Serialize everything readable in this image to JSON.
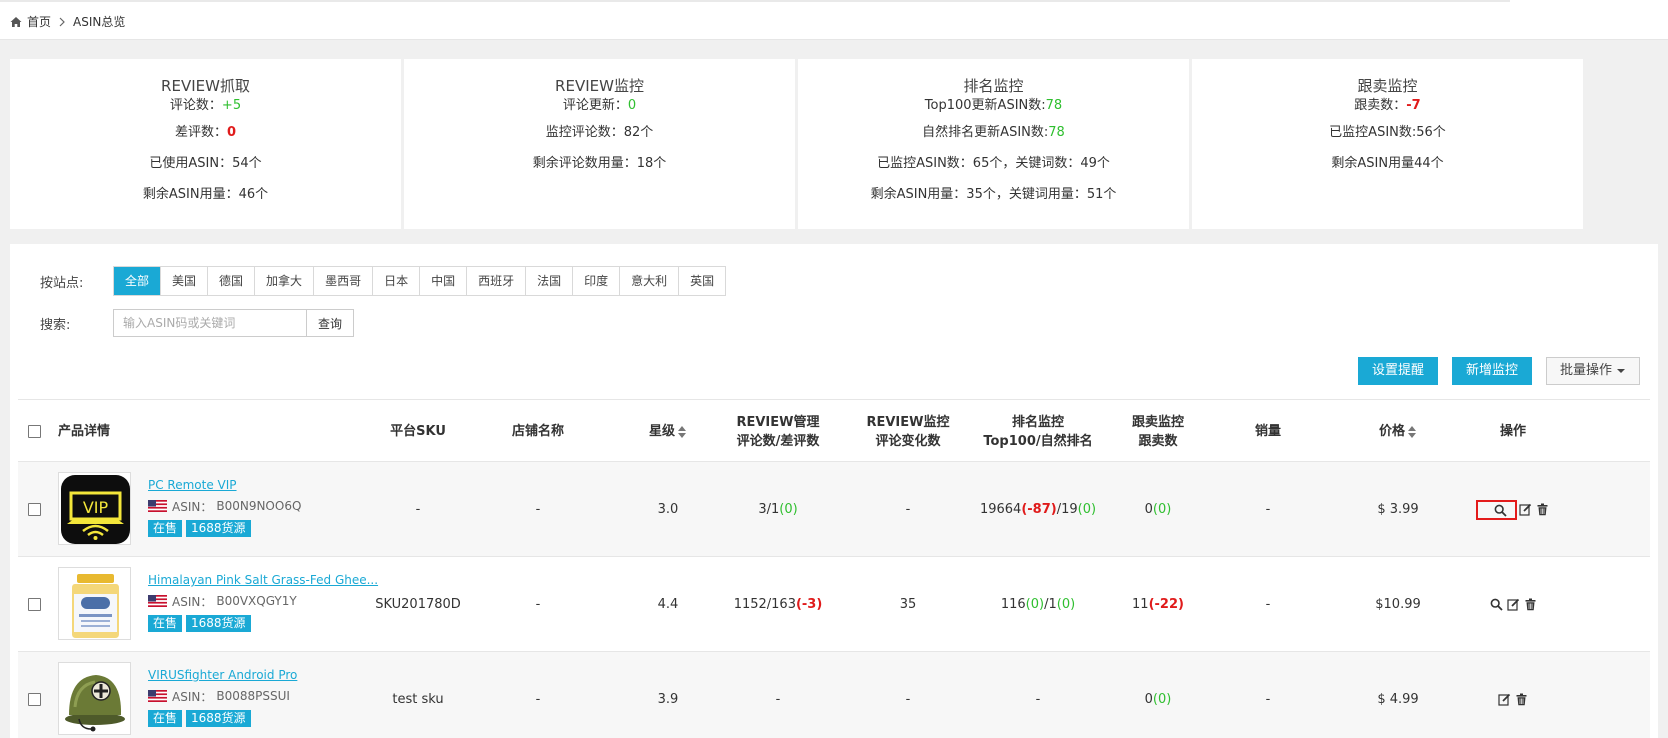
{
  "breadcrumb": {
    "home": "首页",
    "current": "ASIN总览"
  },
  "cards": [
    {
      "title": "REVIEW抓取",
      "rows": [
        {
          "label": "评论数：",
          "value": "+5",
          "style": "green"
        },
        {
          "label": "差评数：",
          "value": "0",
          "style": "red"
        },
        {
          "label": "已使用ASIN：54个",
          "value": "",
          "style": ""
        },
        {
          "label": "剩余ASIN用量：46个",
          "value": "",
          "style": ""
        }
      ]
    },
    {
      "title": "REVIEW监控",
      "rows": [
        {
          "label": "评论更新：",
          "value": "0",
          "style": "green"
        },
        {
          "label": "监控评论数：82个",
          "value": "",
          "style": ""
        },
        {
          "label": "剩余评论数用量：18个",
          "value": "",
          "style": ""
        }
      ]
    },
    {
      "title": "排名监控",
      "rows": [
        {
          "label": "Top100更新ASIN数:",
          "value": "78",
          "style": "green"
        },
        {
          "label": "自然排名更新ASIN数:",
          "value": "78",
          "style": "green"
        },
        {
          "label": "已监控ASIN数：65个，关键词数：49个",
          "value": "",
          "style": ""
        },
        {
          "label": "剩余ASIN用量：35个，关键词用量：51个",
          "value": "",
          "style": ""
        }
      ]
    },
    {
      "title": "跟卖监控",
      "rows": [
        {
          "label": "跟卖数：",
          "value": "-7",
          "style": "red"
        },
        {
          "label": "已监控ASIN数:56个",
          "value": "",
          "style": ""
        },
        {
          "label": "剩余ASIN用量44个",
          "value": "",
          "style": ""
        }
      ]
    }
  ],
  "filter": {
    "label": "按站点:",
    "sites": [
      "全部",
      "美国",
      "德国",
      "加拿大",
      "墨西哥",
      "日本",
      "中国",
      "西班牙",
      "法国",
      "印度",
      "意大利",
      "英国"
    ],
    "active": "全部"
  },
  "search": {
    "label": "搜索:",
    "placeholder": "输入ASIN码或关键词",
    "button": "查询"
  },
  "toolbar": {
    "remind": "设置提醒",
    "add": "新增监控",
    "batch": "批量操作"
  },
  "columns": {
    "product": "产品详情",
    "sku": "平台SKU",
    "store": "店铺名称",
    "stars": "星级",
    "review_mgmt": [
      "REVIEW管理",
      "评论数/差评数"
    ],
    "review_mon": [
      "REVIEW监控",
      "评论变化数"
    ],
    "rank": [
      "排名监控",
      "Top100/自然排名"
    ],
    "follow": [
      "跟卖监控",
      "跟卖数"
    ],
    "sales": "销量",
    "price": "价格",
    "ops": "操作"
  },
  "asin_prefix": "ASIN：",
  "rows": [
    {
      "name": "PC Remote VIP",
      "asin": "B00N9NOO6Q",
      "tags": [
        "在售",
        "1688货源"
      ],
      "sku": "-",
      "store": "-",
      "stars": "3.0",
      "review": {
        "a": "3/1",
        "b": "(0)",
        "b_style": "green"
      },
      "review_change": "-",
      "rank": {
        "top": "19664",
        "top_d": "(-87)",
        "top_d_style": "red",
        "nat": "19",
        "nat_d": "(0)",
        "nat_d_style": "green"
      },
      "follow": {
        "n": "0",
        "d": "(0)",
        "d_style": "green"
      },
      "sales": "-",
      "price": "$ 3.99",
      "ops": [
        "search-icon",
        "edit-icon",
        "delete-icon"
      ],
      "highlight_search": true,
      "thumb": "vip"
    },
    {
      "name": "Himalayan Pink Salt Grass-Fed Ghee...",
      "asin": "B00VXQGY1Y",
      "tags": [
        "在售",
        "1688货源"
      ],
      "sku": "SKU201780D",
      "store": "-",
      "stars": "4.4",
      "review": {
        "a": "1152/163",
        "b": "(-3)",
        "b_style": "red"
      },
      "review_change": "35",
      "rank": {
        "top": "116",
        "top_d": "(0)",
        "top_d_style": "green",
        "nat": "1",
        "nat_d": "(0)",
        "nat_d_style": "green"
      },
      "follow": {
        "n": "11",
        "d": "(-22)",
        "d_style": "red"
      },
      "sales": "-",
      "price": "$10.99",
      "ops": [
        "search-icon",
        "edit-icon",
        "delete-icon"
      ],
      "highlight_search": false,
      "thumb": "jar"
    },
    {
      "name": "VIRUSfighter Android Pro",
      "asin": "B0088PSSUI",
      "tags": [
        "在售",
        "1688货源"
      ],
      "sku": "test sku",
      "store": "-",
      "stars": "3.9",
      "review": {
        "a": "-",
        "b": "",
        "b_style": ""
      },
      "review_change": "-",
      "rank": {
        "top": "-",
        "top_d": "",
        "top_d_style": "",
        "nat": "",
        "nat_d": "",
        "nat_d_style": ""
      },
      "follow": {
        "n": "0",
        "d": "(0)",
        "d_style": "green"
      },
      "sales": "-",
      "price": "$ 4.99",
      "ops": [
        "edit-icon",
        "delete-icon"
      ],
      "highlight_search": false,
      "thumb": "helmet"
    }
  ]
}
